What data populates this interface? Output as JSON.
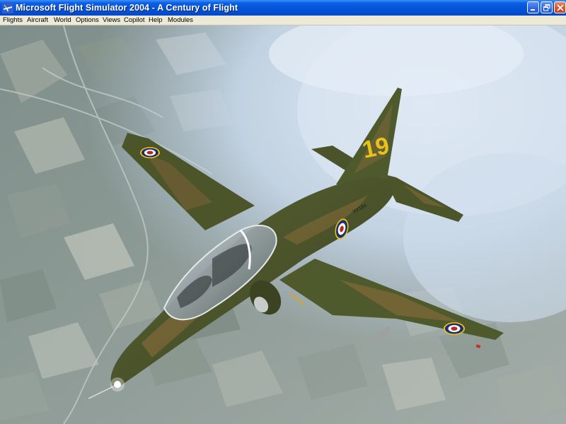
{
  "window": {
    "title": "Microsoft Flight Simulator 2004 - A Century of Flight",
    "icon": "flight-sim-app-icon",
    "controls": {
      "minimize": "minimize-icon",
      "restore": "restore-icon",
      "close": "close-icon"
    }
  },
  "menubar": {
    "items": [
      {
        "label": "Flights"
      },
      {
        "label": "Aircraft"
      },
      {
        "label": "World"
      },
      {
        "label": "Options"
      },
      {
        "label": "Views"
      },
      {
        "label": "Copilot"
      },
      {
        "label": "Help"
      },
      {
        "label": "Modules"
      }
    ]
  },
  "scene": {
    "aircraft_tail_number": "19",
    "aircraft_serial": "XX184",
    "colors": {
      "camo_green": "#4f5a2c",
      "camo_brown": "#7a6638",
      "roundel_blue": "#1f2f6e",
      "roundel_red": "#b5291f",
      "tail_code_yellow": "#e8c21a",
      "sky_haze": "#bcd0e6"
    }
  }
}
